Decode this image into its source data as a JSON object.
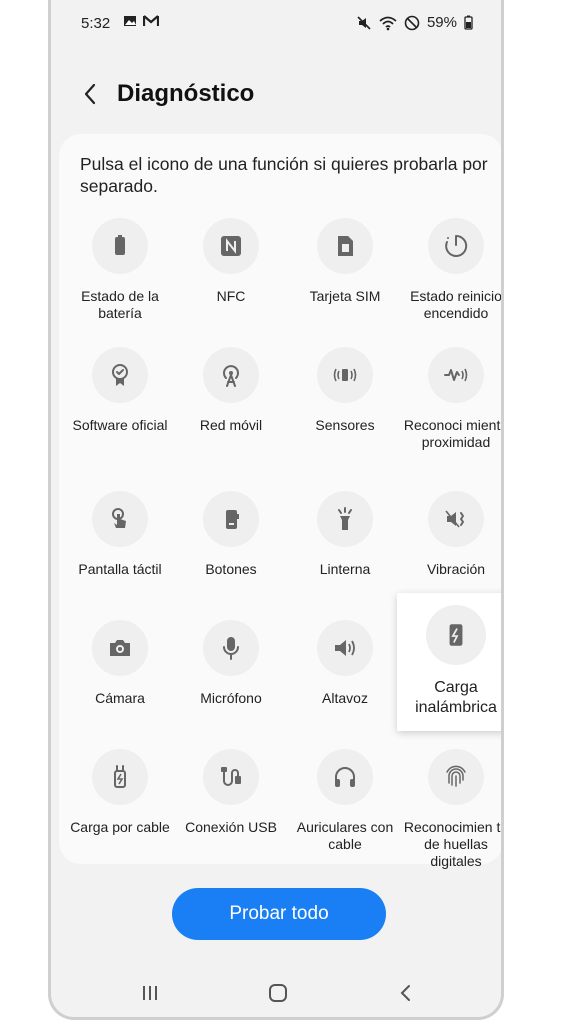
{
  "status_bar": {
    "time": "5:32",
    "battery_percent": "59%"
  },
  "header": {
    "title": "Diagnóstico"
  },
  "description": "Pulsa el icono de una función si quieres probarla por separado.",
  "items": [
    {
      "label": "Estado de la batería",
      "icon": "battery-icon"
    },
    {
      "label": "NFC",
      "icon": "nfc-icon"
    },
    {
      "label": "Tarjeta SIM",
      "icon": "sim-card-icon"
    },
    {
      "label": "Estado reinicio encendido",
      "icon": "power-restart-icon"
    },
    {
      "label": "Software oficial",
      "icon": "badge-icon"
    },
    {
      "label": "Red móvil",
      "icon": "antenna-icon"
    },
    {
      "label": "Sensores",
      "icon": "sensor-icon"
    },
    {
      "label": "Reconoci miento proximidad",
      "icon": "proximity-icon"
    },
    {
      "label": "Pantalla táctil",
      "icon": "touch-icon"
    },
    {
      "label": "Botones",
      "icon": "phone-buttons-icon"
    },
    {
      "label": "Linterna",
      "icon": "flashlight-icon"
    },
    {
      "label": "Vibración",
      "icon": "vibration-icon"
    },
    {
      "label": "Cámara",
      "icon": "camera-icon"
    },
    {
      "label": "Micrófono",
      "icon": "microphone-icon"
    },
    {
      "label": "Altavoz",
      "icon": "speaker-icon"
    },
    {
      "label": "Carga inalámbrica",
      "icon": "wireless-charging-icon"
    },
    {
      "label": "Carga por cable",
      "icon": "cable-charging-icon"
    },
    {
      "label": "Conexión USB",
      "icon": "usb-icon"
    },
    {
      "label": "Auriculares con cable",
      "icon": "headphones-icon"
    },
    {
      "label": "Reconocimien to de huellas digitales",
      "icon": "fingerprint-icon"
    }
  ],
  "highlighted_item": {
    "label": "Carga inalámbrica",
    "icon": "wireless-charging-icon"
  },
  "cta": {
    "label": "Probar todo"
  },
  "nav": {
    "recents": "recents-icon",
    "home": "home-icon",
    "back": "back-icon"
  }
}
